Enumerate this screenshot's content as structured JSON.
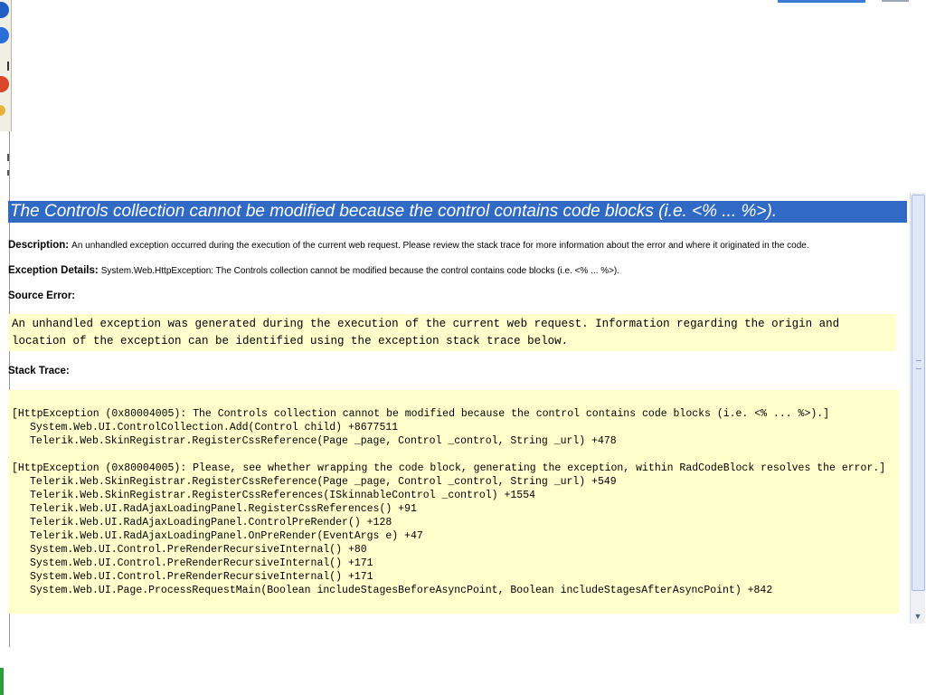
{
  "error": {
    "title": "The Controls collection cannot be modified because the control contains code blocks (i.e. <% ... %>).",
    "description_label": "Description:",
    "description_text": "An unhandled exception occurred during the execution of the current web request. Please review the stack trace for more information about the error and where it originated in the code.",
    "exception_label": "Exception Details:",
    "exception_text": "System.Web.HttpException: The Controls collection cannot be modified because the control contains code blocks (i.e. <% ... %>).",
    "source_label": "Source Error:",
    "source_lines": [
      "An unhandled exception was generated during the execution of the current web request. Information regarding the origin and",
      "location of the exception can be identified using the exception stack trace below."
    ],
    "stack_label": "Stack Trace:",
    "stack_block1_header": "[HttpException (0x80004005): The Controls collection cannot be modified because the control contains code blocks (i.e. <% ... %>).]",
    "stack_block1": [
      "System.Web.UI.ControlCollection.Add(Control child) +8677511",
      "Telerik.Web.SkinRegistrar.RegisterCssReference(Page _page, Control _control, String _url) +478"
    ],
    "stack_block2_header": "[HttpException (0x80004005): Please, see whether wrapping the code block, generating the exception, within RadCodeBlock resolves the error.]",
    "stack_block2": [
      "Telerik.Web.SkinRegistrar.RegisterCssReference(Page _page, Control _control, String _url) +549",
      "Telerik.Web.SkinRegistrar.RegisterCssReferences(ISkinnableControl _control) +1554",
      "Telerik.Web.UI.RadAjaxLoadingPanel.RegisterCssReferences() +91",
      "Telerik.Web.UI.RadAjaxLoadingPanel.ControlPreRender() +128",
      "Telerik.Web.UI.RadAjaxLoadingPanel.OnPreRender(EventArgs e) +47",
      "System.Web.UI.Control.PreRenderRecursiveInternal() +80",
      "System.Web.UI.Control.PreRenderRecursiveInternal() +171",
      "System.Web.UI.Control.PreRenderRecursiveInternal() +171",
      "System.Web.UI.Page.ProcessRequestMain(Boolean includeStagesBeforeAsyncPoint, Boolean includeStagesAfterAsyncPoint) +842"
    ]
  },
  "colors": {
    "title_bg": "#316ac5",
    "code_bg": "#ffffcc"
  }
}
